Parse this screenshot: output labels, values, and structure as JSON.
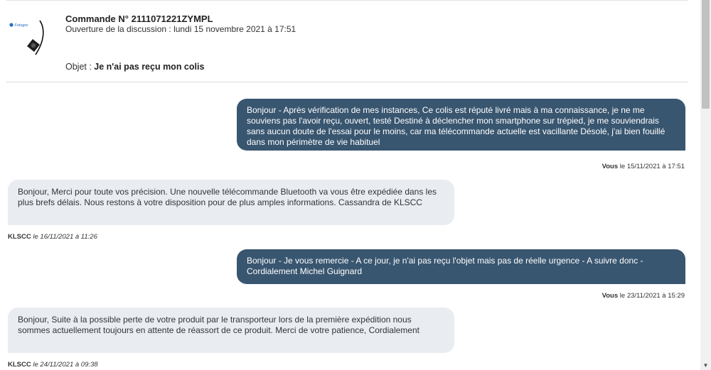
{
  "header": {
    "order_title": "Commande N° 2111071221ZYMPL",
    "open_date": "Ouverture de la discussion : lundi 15 novembre 2021 à 17:51",
    "subject_label": "Objet : ",
    "subject_value": "Je n'ai pas reçu mon colis",
    "product_brand": "Fotogre"
  },
  "messages": [
    {
      "direction": "out",
      "text": "Bonjour - Après vérification de mes instances, Ce colis est réputé livré mais à ma connaissance, je ne me souviens pas l'avoir reçu, ouvert, testé Destiné à déclencher mon smartphone sur trépied, je me souviendrais sans aucun doute de l'essai pour le moins, car ma télécommande actuelle est vacillante Désolé, j'ai bien fouillé dans mon périmètre de vie habituel",
      "author": "Vous",
      "date": " le 15/11/2021 à 17:51"
    },
    {
      "direction": "in",
      "text": "Bonjour, Merci pour toute vos précision. Une nouvelle télécommande Bluetooth va vous être expédiée dans les plus brefs délais. Nous restons à votre disposition pour de plus amples informations. Cassandra de KLSCC",
      "author": "KLSCC",
      "date": " le 16/11/2021 à 11:26"
    },
    {
      "direction": "out",
      "text": "Bonjour - Je vous remercie - A ce jour, je n'ai pas reçu l'objet mais pas de réelle urgence - A suivre donc - Cordialement Michel Guignard",
      "author": "Vous",
      "date": " le 23/11/2021 à 15:29"
    },
    {
      "direction": "in",
      "text": "Bonjour, Suite à la possible perte de votre produit par le transporteur lors de la première expédition nous sommes actuellement toujours en attente de réassort de ce produit. Merci de votre patience, Cordialement",
      "author": "KLSCC",
      "date": " le 24/11/2021 à 09:38"
    }
  ],
  "colors": {
    "outgoing_bubble": "#395670",
    "incoming_bubble": "#e9edf2"
  },
  "icons": {
    "scroll_down": "chevron-down-icon"
  }
}
